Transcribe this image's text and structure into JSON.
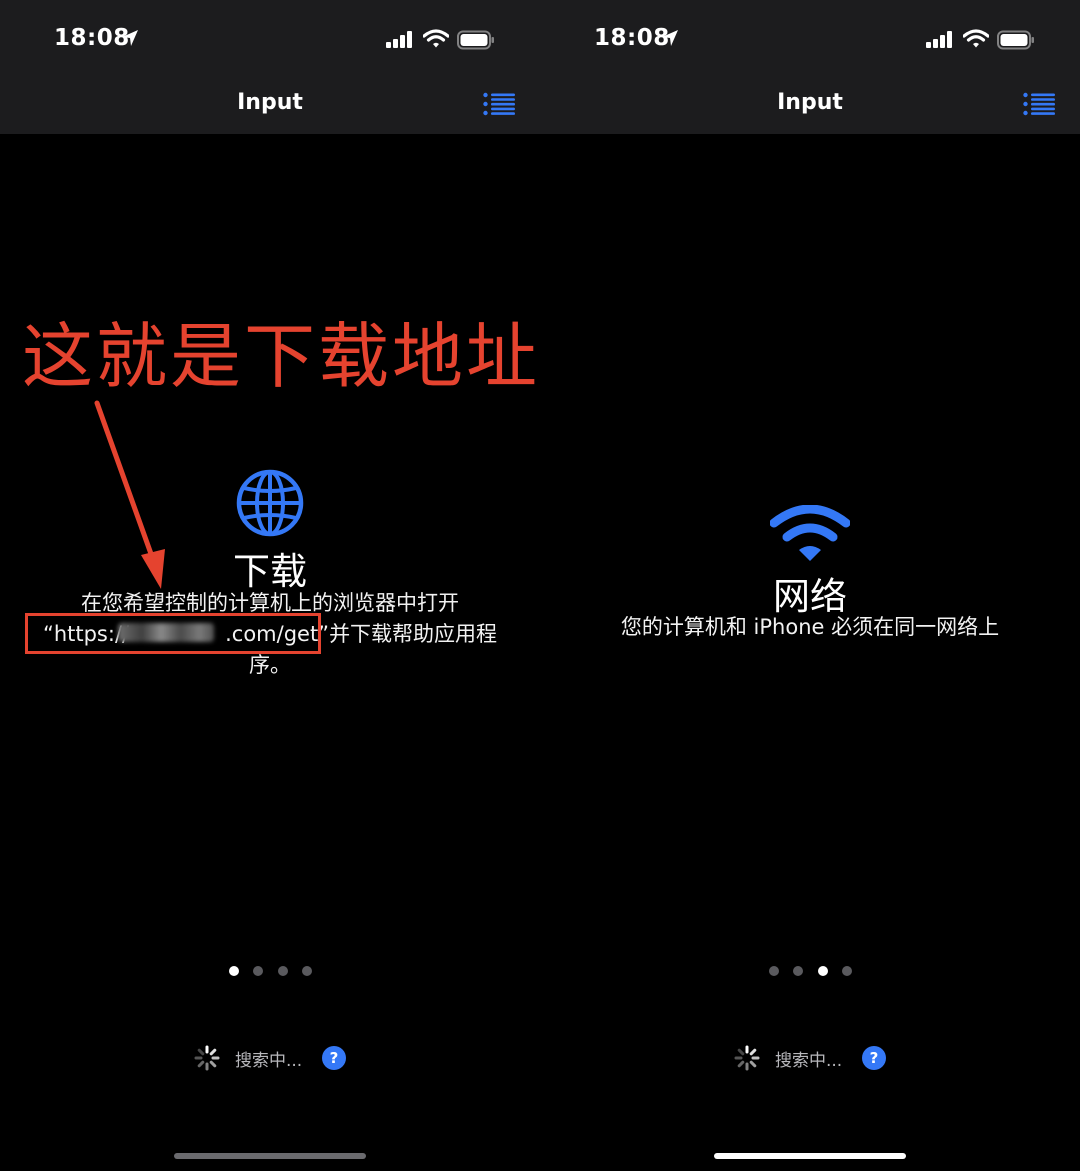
{
  "left_screen": {
    "status": {
      "time": "18:08"
    },
    "nav": {
      "title": "Input"
    },
    "page": {
      "heading": "下载",
      "description_line1": "在您希望控制的计算机上的浏览器中打开",
      "description_line2_url": "“https://",
      "description_line2_url_end": ".com/get”",
      "description_line2_rest": "并下载帮助应用程",
      "description_line3": "序。"
    },
    "pager": {
      "count": 4,
      "active_index": 0
    },
    "footer": {
      "searching_label": "搜索中...",
      "help_label": "?"
    }
  },
  "right_screen": {
    "status": {
      "time": "18:08"
    },
    "nav": {
      "title": "Input"
    },
    "page": {
      "heading": "网络",
      "description": "您的计算机和 iPhone 必须在同一网络上"
    },
    "pager": {
      "count": 4,
      "active_index": 2
    },
    "footer": {
      "searching_label": "搜索中...",
      "help_label": "?"
    }
  },
  "annotation": {
    "text": "这就是下载地址"
  },
  "colors": {
    "accent_blue": "#3478f6",
    "annotation_red": "#e5432f",
    "nav_bar_bg": "#1c1c1e",
    "background": "#000000"
  },
  "icons": {
    "globe": "globe-icon",
    "wifi": "wifi-icon",
    "list": "list-icon",
    "spinner": "spinner-icon",
    "help": "help-icon"
  }
}
